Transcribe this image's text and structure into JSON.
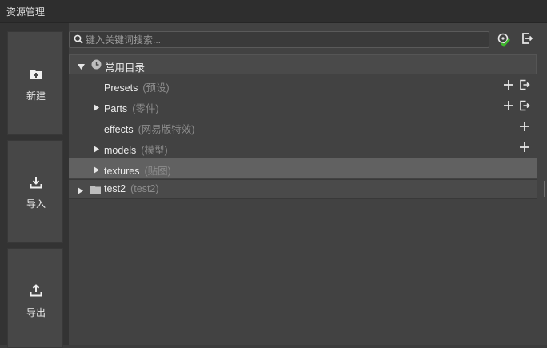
{
  "window": {
    "title": "资源管理"
  },
  "sidebar": {
    "buttons": [
      {
        "label": "新建",
        "icon": "folder-plus-icon"
      },
      {
        "label": "导入",
        "icon": "import-icon"
      },
      {
        "label": "导出",
        "icon": "export-icon"
      }
    ]
  },
  "search": {
    "placeholder": "键入关键词搜索...",
    "value": ""
  },
  "toolbar": {
    "icons": [
      "filter-check-icon",
      "exit-icon"
    ]
  },
  "tree": {
    "common": {
      "label": "常用目录",
      "items": [
        {
          "name": "Presets",
          "sub": "(预设)",
          "expandable": false,
          "actions": [
            "add",
            "exit"
          ]
        },
        {
          "name": "Parts",
          "sub": "(零件)",
          "expandable": true,
          "actions": [
            "add",
            "exit"
          ]
        },
        {
          "name": "effects",
          "sub": "(网易版特效)",
          "expandable": false,
          "actions": [
            "add"
          ]
        },
        {
          "name": "models",
          "sub": "(模型)",
          "expandable": true,
          "actions": [
            "add"
          ]
        },
        {
          "name": "textures",
          "sub": "(贴图)",
          "expandable": true,
          "actions": [],
          "selected": true
        }
      ]
    },
    "folders": [
      {
        "name": "test2",
        "sub": "(test2)",
        "expandable": true
      }
    ]
  },
  "colors": {
    "background": "#424242",
    "selected_row": "#616161",
    "accent_green": "#3dbb2b"
  }
}
